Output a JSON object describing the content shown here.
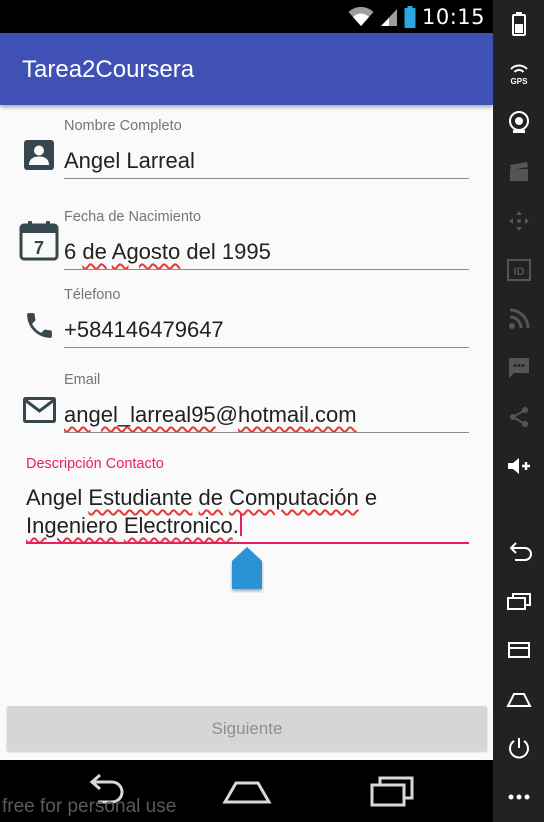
{
  "status_bar": {
    "time": "10:15"
  },
  "app_bar": {
    "title": "Tarea2Coursera"
  },
  "form": {
    "name": {
      "label": "Nombre Completo",
      "value": "Angel Larreal"
    },
    "birth_date": {
      "label": "Fecha de Nacimiento",
      "value_parts": [
        "6",
        "de",
        "Agosto",
        "del 1995"
      ]
    },
    "calendar_day": "7",
    "phone": {
      "label": "Télefono",
      "value": "+584146479647"
    },
    "email": {
      "label": "Email",
      "value_parts": [
        "angel_larreal95",
        "@",
        "hotmail",
        ".com"
      ]
    },
    "description": {
      "label": "Descripción Contacto",
      "value_parts": [
        "Angel",
        "Estudiante",
        "de",
        "Computación",
        "e",
        "Ingeniero",
        "Electronico",
        "."
      ]
    }
  },
  "next_button": {
    "label": "Siguiente"
  },
  "watermark": "free for personal use",
  "icons": {
    "name": "contact-card-icon",
    "birth_date": "calendar-icon",
    "phone": "phone-icon",
    "email": "mail-icon",
    "emulator_sidebar": [
      "battery-icon",
      "gps-icon",
      "camera-icon",
      "clapperboard-icon",
      "dpad-icon",
      "id-icon",
      "rss-icon",
      "sms-icon",
      "share-icon",
      "volume-up-icon",
      "back-icon",
      "recents-icon",
      "menu-icon",
      "home-icon",
      "power-icon",
      "more-icon"
    ]
  },
  "colors": {
    "app_bar": "#3F51B5",
    "accent": "#E91E63",
    "spell_check": "#E53935",
    "handle": "#2A93D5"
  }
}
